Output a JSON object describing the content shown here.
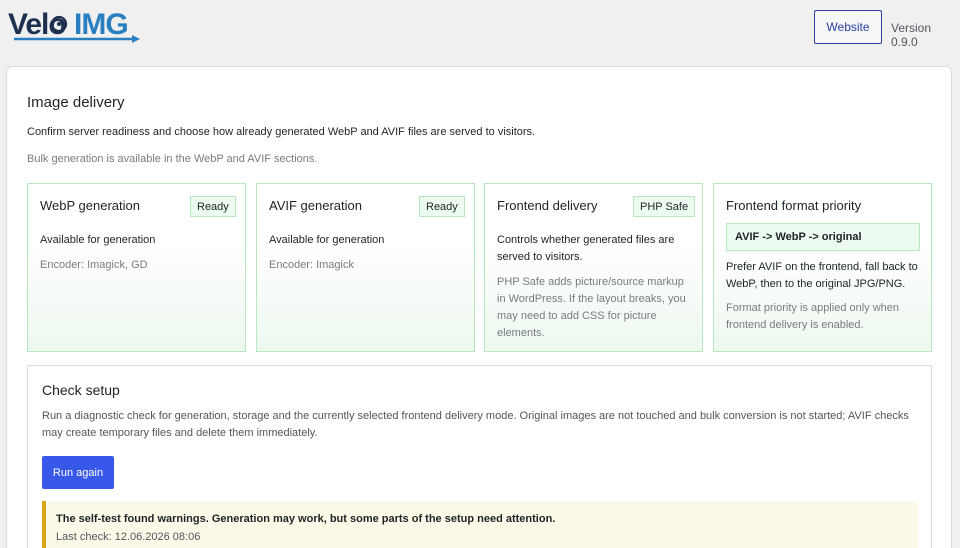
{
  "brand": {
    "logo_text_velo": "Velo",
    "logo_text_img": "IMG",
    "logo_colors": {
      "dark": "#1e3050",
      "blue": "#2a7fc1"
    }
  },
  "header": {
    "website_label": "Website",
    "version": "Version 0.9.0"
  },
  "delivery": {
    "title": "Image delivery",
    "description": "Confirm server readiness and choose how already generated WebP and AVIF files are served to visitors.",
    "note": "Bulk generation is available in the WebP and AVIF sections.",
    "cards": [
      {
        "title": "WebP generation",
        "badge": "Ready",
        "text": "Available for generation",
        "muted": "Encoder: Imagick, GD"
      },
      {
        "title": "AVIF generation",
        "badge": "Ready",
        "text": "Available for generation",
        "muted": "Encoder: Imagick"
      },
      {
        "title": "Frontend delivery",
        "badge": "PHP Safe",
        "text_l1": "Controls whether generated files are",
        "text_l2": "served to visitors.",
        "muted_l1": "PHP Safe adds picture/source markup",
        "muted_l2": "in WordPress. If the layout breaks, you",
        "muted_l3": "may need to add CSS for picture",
        "muted_l4": "elements."
      },
      {
        "title": "Frontend format priority",
        "priority": "AVIF -> WebP -> original",
        "text_l1": "Prefer AVIF on the frontend, fall back to",
        "text_l2": "WebP, then to the original JPG/PNG.",
        "muted_l1": "Format priority is applied only when",
        "muted_l2": "frontend delivery is enabled."
      }
    ]
  },
  "check": {
    "title": "Check setup",
    "desc_l1": "Run a diagnostic check for generation, storage and the currently selected frontend delivery mode. Original images are not touched and bulk conversion is not started; AVIF checks",
    "desc_l2": "may create temporary files and delete them immediately.",
    "run_label": "Run again",
    "notice_main": "The self-test found warnings. Generation may work, but some parts of the setup need attention.",
    "notice_sub": "Last check: 12.06.2026 08:06"
  },
  "colors": {
    "accent": "#3858e9",
    "success_border": "#b8e6bf",
    "warning": "#dba617"
  }
}
